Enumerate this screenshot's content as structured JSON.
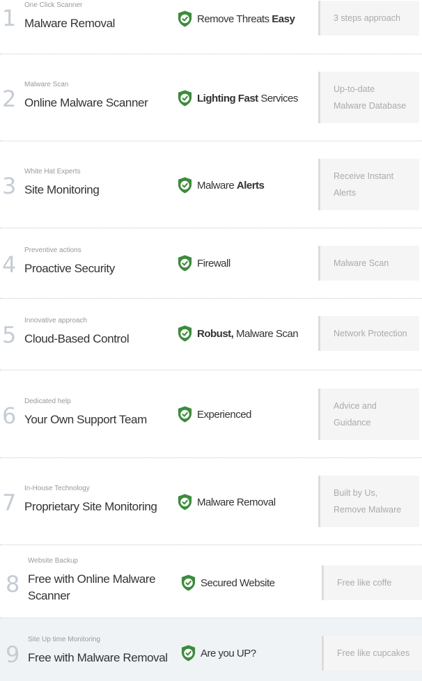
{
  "colors": {
    "shield": "#3d8b3d",
    "number": "#c5ccd4",
    "note_bg": "#f5f5f5",
    "highlight_row_bg": "#f0f3f6"
  },
  "rows": [
    {
      "number": "1",
      "subtitle": "One Click Scanner",
      "title": "Malware Removal",
      "feature": {
        "plain_before": "Remove Threats ",
        "bold": "Easy",
        "plain_after": ""
      },
      "note_lines": [
        "3 steps approach"
      ],
      "icon": "shield-check-icon"
    },
    {
      "number": "2",
      "subtitle": "Malware Scan",
      "title": "Online Malware Scanner",
      "feature": {
        "plain_before": "",
        "bold": "Lighting Fast",
        "plain_after": " Services"
      },
      "note_lines": [
        "Up-to-date",
        "Malware Database"
      ],
      "icon": "shield-check-icon"
    },
    {
      "number": "3",
      "subtitle": "White Hat Experts",
      "title": "Site Monitoring",
      "feature": {
        "plain_before": "Malware ",
        "bold": "Alerts",
        "plain_after": ""
      },
      "note_lines": [
        "Receive Instant",
        "Alerts"
      ],
      "icon": "shield-check-icon"
    },
    {
      "number": "4",
      "subtitle": "Preventive actions",
      "title": "Proactive Security",
      "feature": {
        "plain_before": "Firewall",
        "bold": "",
        "plain_after": ""
      },
      "note_lines": [
        "Malware Scan"
      ],
      "icon": "shield-check-icon"
    },
    {
      "number": "5",
      "subtitle": "Innovative approach",
      "title": "Cloud-Based Control",
      "feature": {
        "plain_before": "",
        "bold": "Robust,",
        "plain_after": " Malware Scan"
      },
      "note_lines": [
        "Network Protection"
      ],
      "icon": "shield-check-icon"
    },
    {
      "number": "6",
      "subtitle": "Dedicated help",
      "title": "Your Own Support Team",
      "feature": {
        "plain_before": "Experienced",
        "bold": "",
        "plain_after": ""
      },
      "note_lines": [
        "Advice and",
        "Guidance"
      ],
      "icon": "shield-check-icon"
    },
    {
      "number": "7",
      "subtitle": "In-House Technology",
      "title": "Proprietary Site Monitoring",
      "feature": {
        "plain_before": "Malware Removal",
        "bold": "",
        "plain_after": ""
      },
      "note_lines": [
        "Built by Us,",
        "Remove Malware"
      ],
      "icon": "shield-check-icon"
    },
    {
      "number": "8",
      "subtitle": "Website Backup",
      "title": "Free with Online Malware Scanner",
      "feature": {
        "plain_before": "Secured Website",
        "bold": "",
        "plain_after": ""
      },
      "note_lines": [
        "Free like coffe"
      ],
      "icon": "shield-check-icon"
    },
    {
      "number": "9",
      "subtitle": "Site Up time Monitoring",
      "title": "Free with Malware Removal",
      "feature": {
        "plain_before": "Are you UP?",
        "bold": "",
        "plain_after": ""
      },
      "note_lines": [
        "Free like cupcakes"
      ],
      "icon": "shield-check-icon"
    }
  ]
}
